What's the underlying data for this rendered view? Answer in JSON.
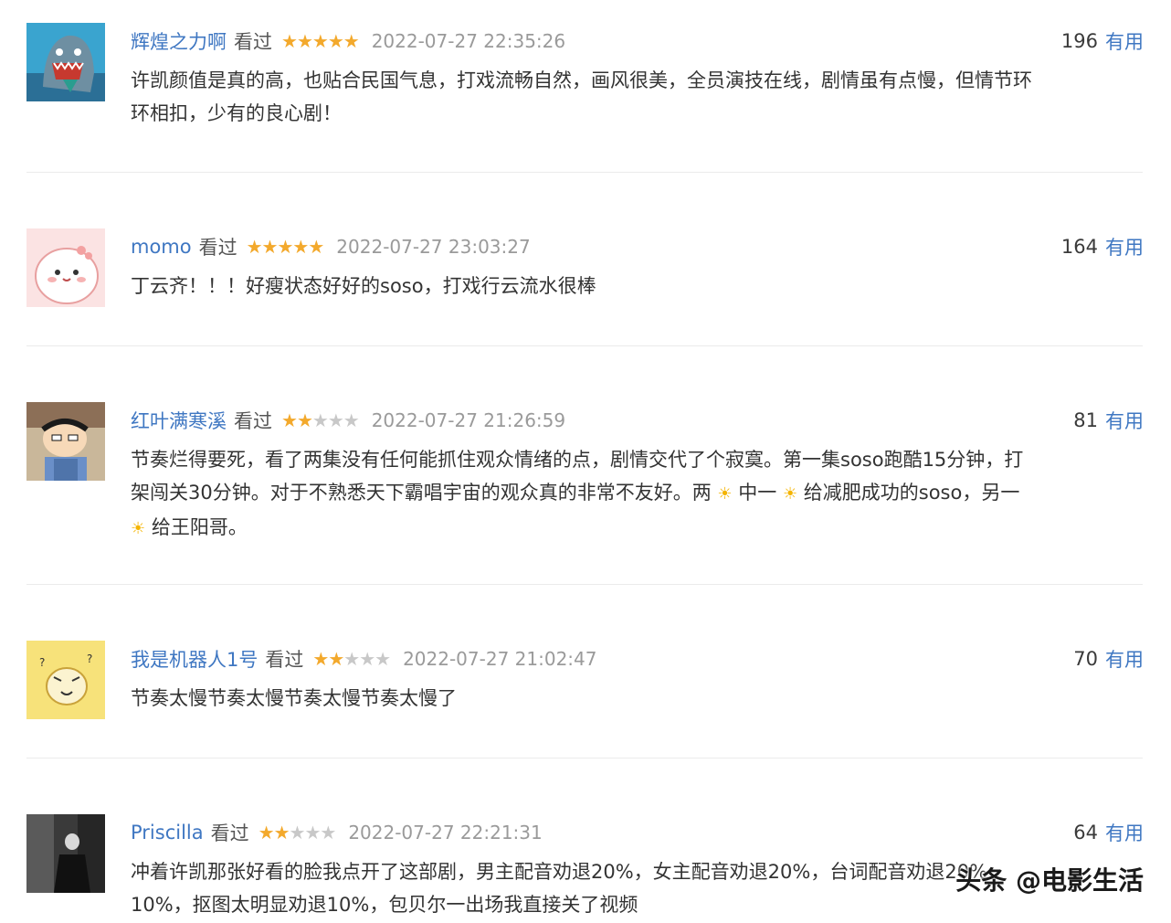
{
  "reviews": [
    {
      "username": "辉煌之力啊",
      "status": "看过",
      "rating": 5,
      "date": "2022-07-27 22:35:26",
      "votes": "196",
      "votes_label": "有用",
      "content": [
        "许凯颜值是真的高，也贴合民国气息，打戏流畅自然，画风很美，全员演技在线，剧情虽有点慢，但情节环",
        "环相扣，少有的良心剧！"
      ]
    },
    {
      "username": "momo",
      "status": "看过",
      "rating": 5,
      "date": "2022-07-27 23:03:27",
      "votes": "164",
      "votes_label": "有用",
      "content": [
        "丁云齐！！！好瘦状态好好的soso，打戏行云流水很棒"
      ]
    },
    {
      "username": "红叶满寒溪",
      "status": "看过",
      "rating": 2,
      "date": "2022-07-27 21:26:59",
      "votes": "81",
      "votes_label": "有用",
      "content": {
        "line1": "节奏烂得要死，看了两集没有任何能抓住观众情绪的点，剧情交代了个寂寞。第一集soso跑酷15分钟，打",
        "line2_a": "架闯关30分钟。对于不熟悉天下霸唱宇宙的观众真的非常不友好。两",
        "line2_b": "中一",
        "line2_c": "给减肥成功的soso，另一",
        "line3": "给王阳哥。"
      }
    },
    {
      "username": "我是机器人1号",
      "status": "看过",
      "rating": 2,
      "date": "2022-07-27 21:02:47",
      "votes": "70",
      "votes_label": "有用",
      "content": [
        "节奏太慢节奏太慢节奏太慢节奏太慢了"
      ]
    },
    {
      "username": "Priscilla",
      "status": "看过",
      "rating": 2,
      "date": "2022-07-27 22:21:31",
      "votes": "64",
      "votes_label": "有用",
      "content": [
        "冲着许凯那张好看的脸我点开了这部剧，男主配音劝退20%，女主配音劝退20%，台词配音劝退20%",
        "10%，抠图太明显劝退10%，包贝尔一出场我直接关了视频"
      ]
    }
  ],
  "watermark": "头条 @电影生活",
  "colors": {
    "link": "#3f77c2",
    "star": "#f3a92c",
    "star_off": "#c8c8c8"
  }
}
